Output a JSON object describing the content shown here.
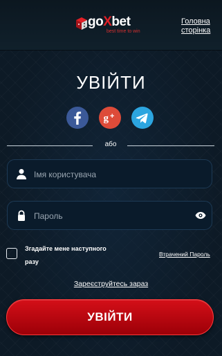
{
  "header": {
    "logo": {
      "text_main": "go",
      "text_x": "X",
      "text_end": "bet",
      "tagline": "best time to win"
    },
    "home_link": "Головна сторінка"
  },
  "login": {
    "title": "УВІЙТИ",
    "social_icons": [
      "facebook-icon",
      "google-plus-icon",
      "telegram-icon"
    ],
    "or_text": "або",
    "username_placeholder": "Імя користувача",
    "password_placeholder": "Пароль",
    "remember_label": "Згадайте мене наступного разу",
    "remember_checked": false,
    "lost_password": "Втрачений Пароль",
    "register_link": "Зареєструйтесь зараз",
    "submit_label": "УВІЙТИ"
  },
  "colors": {
    "background": "#0d1a26",
    "accent_red": "#e01f26",
    "facebook": "#3b5998",
    "google_plus": "#dd4b39",
    "telegram": "#2ca5e0"
  }
}
